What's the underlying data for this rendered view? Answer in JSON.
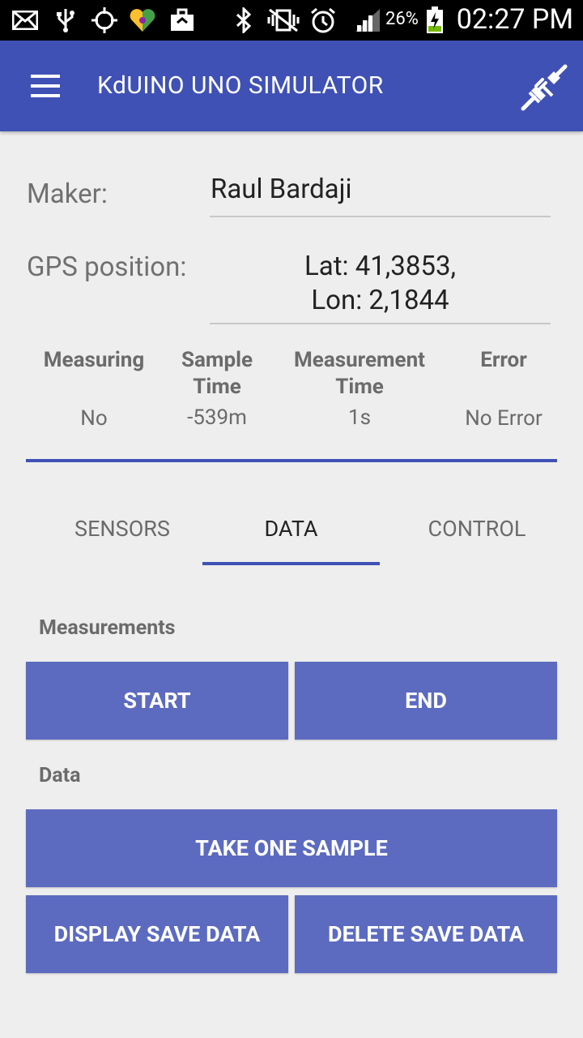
{
  "status_bar": {
    "battery_percent": "26%",
    "time": "02:27 PM",
    "icons": [
      "mail-icon",
      "usb-icon",
      "gps-icon",
      "heart-app-icon",
      "briefcase-icon",
      "bluetooth-icon",
      "vibrate-off-icon",
      "alarm-icon",
      "signal-icon",
      "battery-charging-icon"
    ]
  },
  "app_bar": {
    "title": "KdUINO UNO SIMULATOR",
    "menu_icon": "hamburger-menu-icon",
    "connect_icon": "plug-disconnected-icon"
  },
  "form": {
    "maker_label": "Maker:",
    "maker_value": "Raul Bardaji",
    "gps_label": "GPS position:",
    "gps_line1": "Lat: 41,3853,",
    "gps_line2": "Lon: 2,1844"
  },
  "status_grid": {
    "columns": [
      {
        "header": "Measuring",
        "value": "No"
      },
      {
        "header": "Sample Time",
        "value": "-539m"
      },
      {
        "header": "Measurement Time",
        "value": "1s"
      },
      {
        "header": "Error",
        "value": "No Error"
      }
    ]
  },
  "tabs": [
    {
      "label": "SENSORS",
      "active": false
    },
    {
      "label": "DATA",
      "active": true
    },
    {
      "label": "CONTROL",
      "active": false
    }
  ],
  "measurements": {
    "title": "Measurements",
    "start_label": "START",
    "end_label": "END"
  },
  "data_section": {
    "title": "Data",
    "take_sample_label": "TAKE ONE SAMPLE",
    "display_label": "DISPLAY SAVE DATA",
    "delete_label": "DELETE SAVE DATA"
  },
  "colors": {
    "primary": "#3f51b5",
    "button": "#5c6bc0",
    "background": "#eeeeee"
  }
}
